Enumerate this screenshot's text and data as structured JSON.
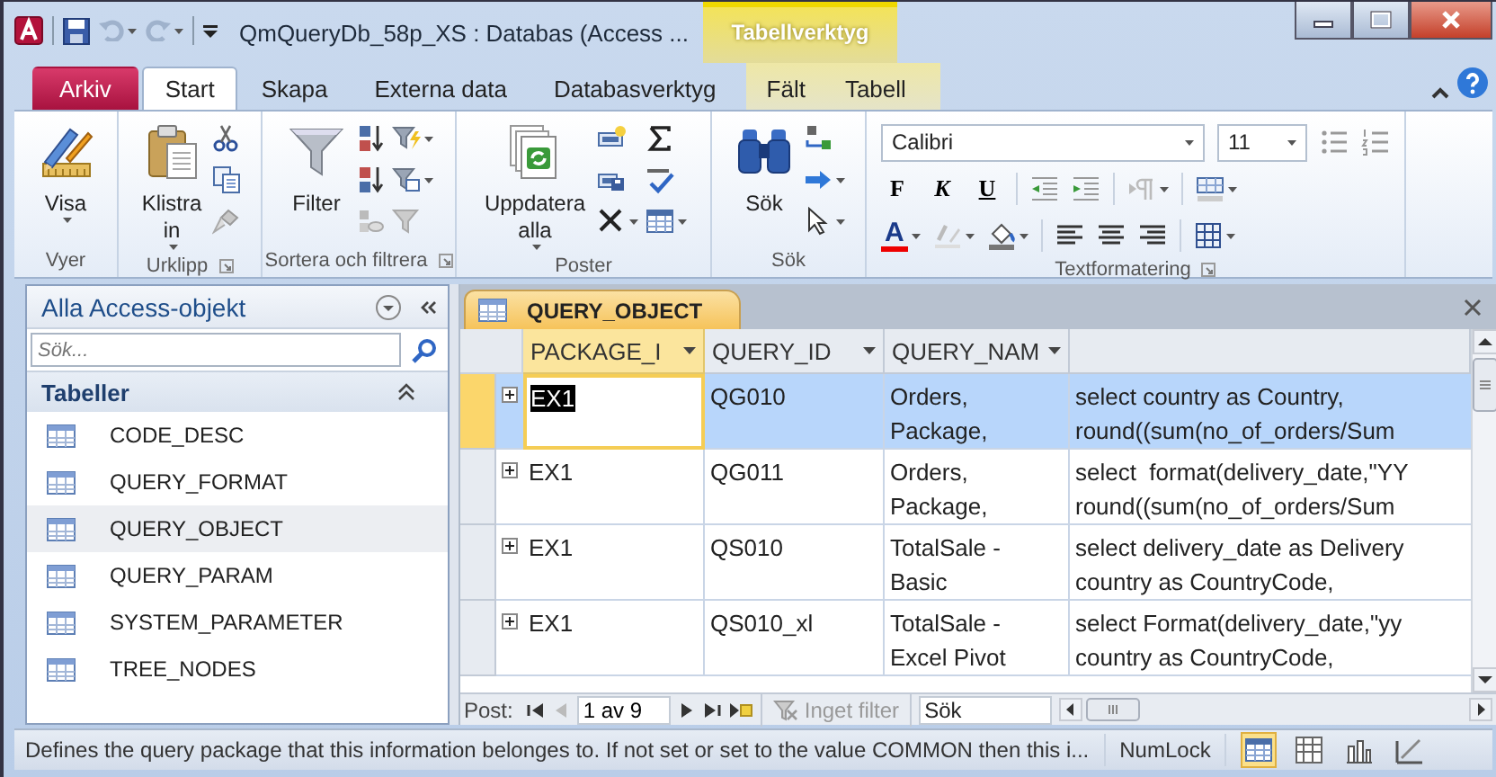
{
  "window": {
    "title": "QmQueryDb_58p_XS : Databas (Access ...",
    "context_tab": "Tabellverktyg"
  },
  "ribbon_tabs": [
    {
      "label": "Arkiv",
      "kind": "file",
      "selected": false
    },
    {
      "label": "Start",
      "kind": "main",
      "selected": true
    },
    {
      "label": "Skapa",
      "kind": "main",
      "selected": false
    },
    {
      "label": "Externa data",
      "kind": "main",
      "selected": false
    },
    {
      "label": "Databasverktyg",
      "kind": "main",
      "selected": false
    },
    {
      "label": "Fält",
      "kind": "context",
      "selected": false
    },
    {
      "label": "Tabell",
      "kind": "context",
      "selected": false
    }
  ],
  "ribbon_groups": [
    {
      "label": "Vyer",
      "kind": "buttons",
      "buttons": [
        {
          "label": "Visa",
          "dropdown": true
        }
      ]
    },
    {
      "label": "Urklipp",
      "kind": "buttons",
      "launcher": true,
      "buttons": [
        {
          "label": "Klistra in",
          "dropdown": true
        }
      ]
    },
    {
      "label": "Sortera och filtrera",
      "kind": "buttons",
      "launcher": true,
      "buttons": [
        {
          "label": "Filter",
          "dropdown": false
        }
      ]
    },
    {
      "label": "Poster",
      "kind": "buttons",
      "buttons": [
        {
          "label": "Uppdatera alla",
          "dropdown": true
        }
      ]
    },
    {
      "label": "Sök",
      "kind": "buttons",
      "buttons": [
        {
          "label": "Sök",
          "dropdown": false
        }
      ]
    },
    {
      "label": "Textformatering",
      "kind": "text_format",
      "launcher": true,
      "font": "Calibri",
      "size": "11",
      "format_buttons": [
        {
          "label": "F",
          "kind": "bold"
        },
        {
          "label": "K",
          "kind": "italic"
        },
        {
          "label": "U",
          "kind": "underline"
        }
      ],
      "font_color_button": "A"
    }
  ],
  "navigation_pane": {
    "title": "Alla Access-objekt",
    "search": {
      "placeholder": "Sök..."
    },
    "section": "Tabeller",
    "items": [
      {
        "label": "CODE_DESC",
        "selected": false
      },
      {
        "label": "QUERY_FORMAT",
        "selected": false
      },
      {
        "label": "QUERY_OBJECT",
        "selected": true
      },
      {
        "label": "QUERY_PARAM",
        "selected": false
      },
      {
        "label": "SYSTEM_PARAMETER",
        "selected": false
      },
      {
        "label": "TREE_NODES",
        "selected": false
      }
    ]
  },
  "document_tab": {
    "label": "QUERY_OBJECT"
  },
  "table": {
    "columns": [
      {
        "label": "PACKAGE_I",
        "selected": true,
        "dropdown": true
      },
      {
        "label": "QUERY_ID",
        "selected": false,
        "dropdown": true
      },
      {
        "label": "QUERY_NAM",
        "selected": false,
        "dropdown": true
      },
      {
        "selected": false,
        "dropdown": false
      }
    ],
    "rows": [
      {
        "selected": true,
        "cells": [
          "EX1",
          "QG010",
          "Orders, Package,",
          "select country as Country,\nround((sum(no_of_orders/Sum"
        ]
      },
      {
        "selected": false,
        "cells": [
          "EX1",
          "QG011",
          "Orders, Package,",
          "select  format(delivery_date,\"YY\nround((sum(no_of_orders/Sum"
        ]
      },
      {
        "selected": false,
        "cells": [
          "EX1",
          "QS010",
          "TotalSale - Basic",
          "select delivery_date as Delivery\ncountry as CountryCode,"
        ]
      },
      {
        "selected": false,
        "cells": [
          "EX1",
          "QS010_xl",
          "TotalSale - Excel Pivot",
          "select Format(delivery_date,\"yy\ncountry as CountryCode,"
        ]
      }
    ]
  },
  "record_navigation": {
    "label": "Post:",
    "position": "1 av 9",
    "filter": "Inget filter",
    "search": {
      "placeholder": "Sök"
    }
  },
  "status_bar": {
    "message": "Defines the query package that this information belonges to. If not set or set to the value COMMON then this i...",
    "indicator": "NumLock",
    "views": [
      {
        "selected": true
      },
      {
        "selected": false
      },
      {
        "selected": false
      },
      {
        "selected": false
      }
    ]
  }
}
